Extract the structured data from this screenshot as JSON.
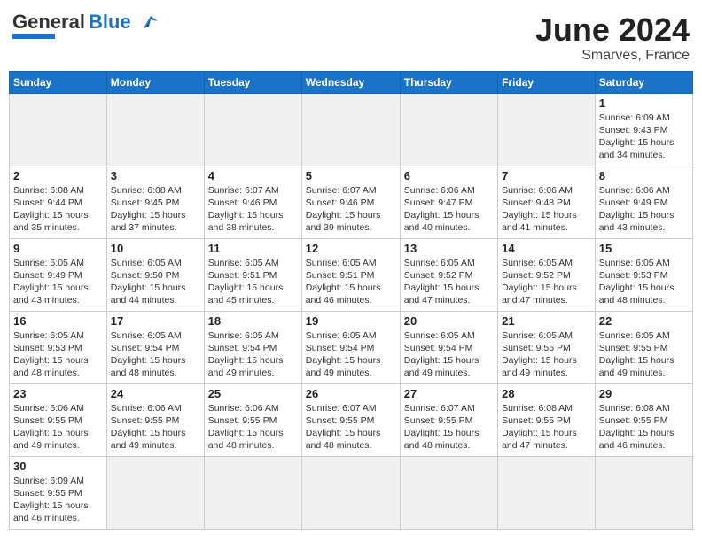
{
  "header": {
    "logo_general": "General",
    "logo_blue": "Blue",
    "month_year": "June 2024",
    "location": "Smarves, France"
  },
  "days_of_week": [
    "Sunday",
    "Monday",
    "Tuesday",
    "Wednesday",
    "Thursday",
    "Friday",
    "Saturday"
  ],
  "weeks": [
    [
      {
        "day": "",
        "info": ""
      },
      {
        "day": "",
        "info": ""
      },
      {
        "day": "",
        "info": ""
      },
      {
        "day": "",
        "info": ""
      },
      {
        "day": "",
        "info": ""
      },
      {
        "day": "",
        "info": ""
      },
      {
        "day": "1",
        "info": "Sunrise: 6:09 AM\nSunset: 9:43 PM\nDaylight: 15 hours\nand 34 minutes."
      }
    ],
    [
      {
        "day": "2",
        "info": "Sunrise: 6:08 AM\nSunset: 9:44 PM\nDaylight: 15 hours\nand 35 minutes."
      },
      {
        "day": "3",
        "info": "Sunrise: 6:08 AM\nSunset: 9:45 PM\nDaylight: 15 hours\nand 37 minutes."
      },
      {
        "day": "4",
        "info": "Sunrise: 6:07 AM\nSunset: 9:46 PM\nDaylight: 15 hours\nand 38 minutes."
      },
      {
        "day": "5",
        "info": "Sunrise: 6:07 AM\nSunset: 9:46 PM\nDaylight: 15 hours\nand 39 minutes."
      },
      {
        "day": "6",
        "info": "Sunrise: 6:06 AM\nSunset: 9:47 PM\nDaylight: 15 hours\nand 40 minutes."
      },
      {
        "day": "7",
        "info": "Sunrise: 6:06 AM\nSunset: 9:48 PM\nDaylight: 15 hours\nand 41 minutes."
      },
      {
        "day": "8",
        "info": "Sunrise: 6:06 AM\nSunset: 9:49 PM\nDaylight: 15 hours\nand 43 minutes."
      }
    ],
    [
      {
        "day": "9",
        "info": "Sunrise: 6:05 AM\nSunset: 9:49 PM\nDaylight: 15 hours\nand 43 minutes."
      },
      {
        "day": "10",
        "info": "Sunrise: 6:05 AM\nSunset: 9:50 PM\nDaylight: 15 hours\nand 44 minutes."
      },
      {
        "day": "11",
        "info": "Sunrise: 6:05 AM\nSunset: 9:51 PM\nDaylight: 15 hours\nand 45 minutes."
      },
      {
        "day": "12",
        "info": "Sunrise: 6:05 AM\nSunset: 9:51 PM\nDaylight: 15 hours\nand 46 minutes."
      },
      {
        "day": "13",
        "info": "Sunrise: 6:05 AM\nSunset: 9:52 PM\nDaylight: 15 hours\nand 47 minutes."
      },
      {
        "day": "14",
        "info": "Sunrise: 6:05 AM\nSunset: 9:52 PM\nDaylight: 15 hours\nand 47 minutes."
      },
      {
        "day": "15",
        "info": "Sunrise: 6:05 AM\nSunset: 9:53 PM\nDaylight: 15 hours\nand 48 minutes."
      }
    ],
    [
      {
        "day": "16",
        "info": "Sunrise: 6:05 AM\nSunset: 9:53 PM\nDaylight: 15 hours\nand 48 minutes."
      },
      {
        "day": "17",
        "info": "Sunrise: 6:05 AM\nSunset: 9:54 PM\nDaylight: 15 hours\nand 48 minutes."
      },
      {
        "day": "18",
        "info": "Sunrise: 6:05 AM\nSunset: 9:54 PM\nDaylight: 15 hours\nand 49 minutes."
      },
      {
        "day": "19",
        "info": "Sunrise: 6:05 AM\nSunset: 9:54 PM\nDaylight: 15 hours\nand 49 minutes."
      },
      {
        "day": "20",
        "info": "Sunrise: 6:05 AM\nSunset: 9:54 PM\nDaylight: 15 hours\nand 49 minutes."
      },
      {
        "day": "21",
        "info": "Sunrise: 6:05 AM\nSunset: 9:55 PM\nDaylight: 15 hours\nand 49 minutes."
      },
      {
        "day": "22",
        "info": "Sunrise: 6:05 AM\nSunset: 9:55 PM\nDaylight: 15 hours\nand 49 minutes."
      }
    ],
    [
      {
        "day": "23",
        "info": "Sunrise: 6:06 AM\nSunset: 9:55 PM\nDaylight: 15 hours\nand 49 minutes."
      },
      {
        "day": "24",
        "info": "Sunrise: 6:06 AM\nSunset: 9:55 PM\nDaylight: 15 hours\nand 49 minutes."
      },
      {
        "day": "25",
        "info": "Sunrise: 6:06 AM\nSunset: 9:55 PM\nDaylight: 15 hours\nand 48 minutes."
      },
      {
        "day": "26",
        "info": "Sunrise: 6:07 AM\nSunset: 9:55 PM\nDaylight: 15 hours\nand 48 minutes."
      },
      {
        "day": "27",
        "info": "Sunrise: 6:07 AM\nSunset: 9:55 PM\nDaylight: 15 hours\nand 48 minutes."
      },
      {
        "day": "28",
        "info": "Sunrise: 6:08 AM\nSunset: 9:55 PM\nDaylight: 15 hours\nand 47 minutes."
      },
      {
        "day": "29",
        "info": "Sunrise: 6:08 AM\nSunset: 9:55 PM\nDaylight: 15 hours\nand 46 minutes."
      }
    ],
    [
      {
        "day": "30",
        "info": "Sunrise: 6:09 AM\nSunset: 9:55 PM\nDaylight: 15 hours\nand 46 minutes."
      },
      {
        "day": "",
        "info": ""
      },
      {
        "day": "",
        "info": ""
      },
      {
        "day": "",
        "info": ""
      },
      {
        "day": "",
        "info": ""
      },
      {
        "day": "",
        "info": ""
      },
      {
        "day": "",
        "info": ""
      }
    ]
  ]
}
